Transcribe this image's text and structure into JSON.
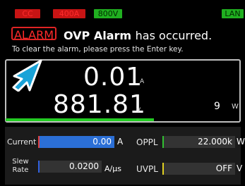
{
  "status": {
    "cc": "CC",
    "range_current": "400A",
    "range_voltage": "800V",
    "lan": "LAN"
  },
  "alarm": {
    "badge": "ALARM",
    "title_bold": "OVP Alarm",
    "title_rest": "has occurred.",
    "message": "To clear the alarm, please press the Enter key."
  },
  "measurement": {
    "current_value": "0.01",
    "current_unit": "A",
    "voltage_value": "881.81",
    "voltage_unit": "V",
    "power_value": "9",
    "power_unit": "W"
  },
  "settings": {
    "current_label": "Current",
    "current_value": "0.00",
    "current_unit": "A",
    "slew_label_1": "Slew",
    "slew_label_2": "Rate",
    "slew_value": "0.0200",
    "slew_unit": "A/µs",
    "oppl_label": "OPPL",
    "oppl_value": "22.000k",
    "oppl_unit": "W",
    "uvpl_label": "UVPL",
    "uvpl_value": "OFF",
    "uvpl_unit": "V"
  },
  "colors": {
    "alarm_red": "#e02424",
    "status_red": "#c81414",
    "status_green": "#20b020",
    "active_field": "#2b6fd6",
    "current_marker": "#e04040",
    "slew_marker": "#3060e0",
    "oppl_marker": "#30c030",
    "uvpl_marker": "#e0d020"
  },
  "icons": {
    "pointer": "arrow-pointer-icon"
  }
}
